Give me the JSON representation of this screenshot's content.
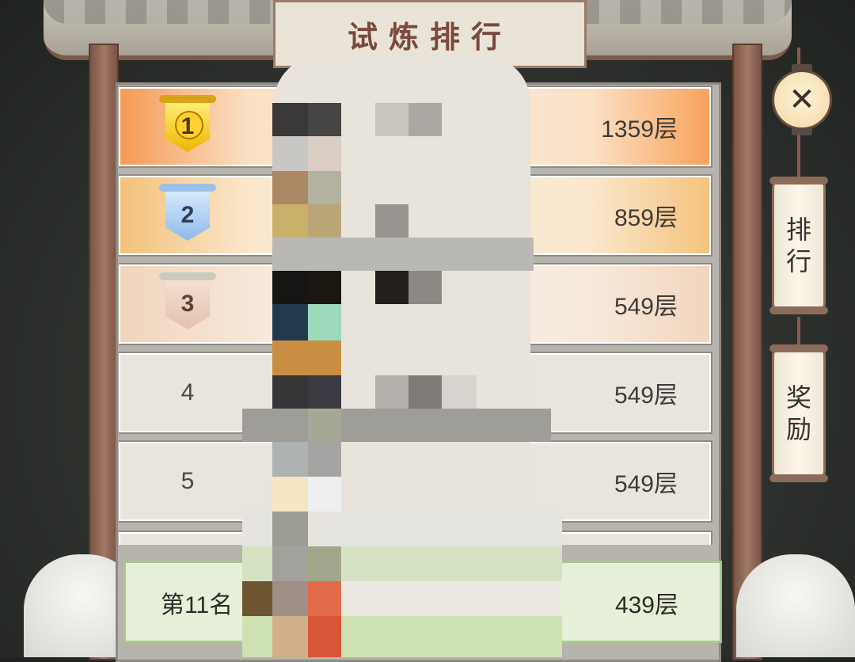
{
  "title": "试炼排行",
  "close_icon": "close-icon",
  "side_buttons": {
    "ranking": [
      "排",
      "行"
    ],
    "reward": [
      "奖",
      "励"
    ]
  },
  "rows": [
    {
      "rank": "1",
      "score": "1359层",
      "badge": "gold"
    },
    {
      "rank": "2",
      "score": "859层",
      "badge": "silver"
    },
    {
      "rank": "3",
      "score": "549层",
      "badge": "bronze"
    },
    {
      "rank": "4",
      "score": "549层"
    },
    {
      "rank": "5",
      "score": "549层"
    }
  ],
  "my_rank": {
    "label": "第11名",
    "score": "439层"
  },
  "colors": {
    "gold": "#f0b400",
    "silver": "#8fb9e8",
    "bronze": "#e3c2ad",
    "highlight": "#a8c98a"
  }
}
